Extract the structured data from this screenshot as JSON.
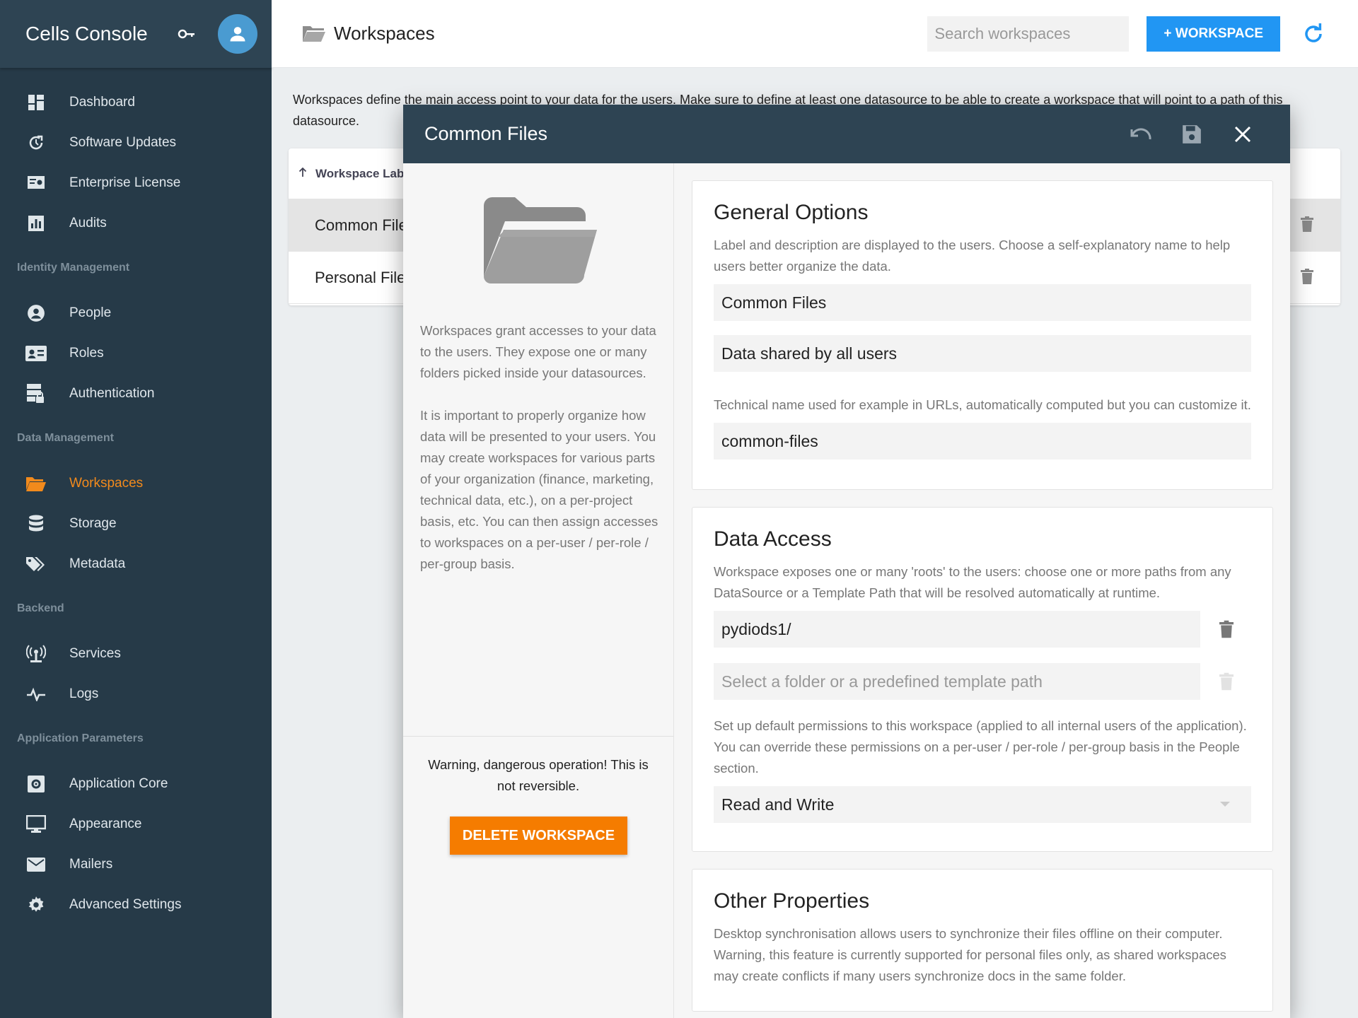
{
  "app": {
    "title": "Cells Console"
  },
  "sidebar": {
    "items": [
      {
        "label": "Dashboard",
        "icon": "dashboard-icon"
      },
      {
        "label": "Software Updates",
        "icon": "update-icon"
      },
      {
        "label": "Enterprise License",
        "icon": "license-icon"
      },
      {
        "label": "Audits",
        "icon": "audits-icon"
      }
    ],
    "sections": [
      {
        "label": "Identity Management",
        "items": [
          "People",
          "Roles",
          "Authentication"
        ]
      },
      {
        "label": "Data Management",
        "items": [
          "Workspaces",
          "Storage",
          "Metadata"
        ]
      },
      {
        "label": "Backend",
        "items": [
          "Services",
          "Logs"
        ]
      },
      {
        "label": "Application Parameters",
        "items": [
          "Application Core",
          "Appearance",
          "Mailers",
          "Advanced Settings"
        ]
      }
    ],
    "active": "Workspaces",
    "active_color": "#f28a1c"
  },
  "topbar": {
    "title": "Workspaces",
    "search_placeholder": "Search workspaces",
    "add_label": "+ WORKSPACE",
    "accent": "#2196f3"
  },
  "page": {
    "description": "Workspaces define the main access point to your data for the users. Make sure to define at least one datasource to be able to create a workspace that will point to a path of this datasource.",
    "table": {
      "header": "Workspace Label",
      "rows": [
        "Common Files",
        "Personal Files"
      ]
    }
  },
  "modal": {
    "title": "Common Files",
    "help_p1": "Workspaces grant accesses to your data to the users. They expose one or many folders picked inside your datasources.",
    "help_p2": "It is important to properly organize how data will be presented to your users. You may create workspaces for various parts of your organization (finance, marketing, technical data, etc.), on a per-project basis, etc. You can then assign accesses to workspaces on a per-user / per-role / per-group basis.",
    "warning": "Warning, dangerous operation! This is not reversible.",
    "delete_label": "DELETE WORKSPACE",
    "delete_color": "#f57c00",
    "general": {
      "title": "General Options",
      "legend": "Label and description are displayed to the users. Choose a self-explanatory name to help users better organize the data.",
      "label_value": "Common Files",
      "description_value": "Data shared by all users",
      "slug_legend": "Technical name used for example in URLs, automatically computed but you can customize it.",
      "slug_value": "common-files"
    },
    "access": {
      "title": "Data Access",
      "legend": "Workspace exposes one or many 'roots' to the users: choose one or more paths from any DataSource or a Template Path that will be resolved automatically at runtime.",
      "root_value": "pydiods1/",
      "root_placeholder": "Select a folder or a predefined template path",
      "perm_legend": "Set up default permissions to this workspace (applied to all internal users of the application). You can override these permissions on a per-user / per-role / per-group basis in the People section.",
      "perm_value": "Read and Write"
    },
    "other": {
      "title": "Other Properties",
      "legend": "Desktop synchronisation allows users to synchronize their files offline on their computer. Warning, this feature is currently supported for personal files only, as shared workspaces may create conflicts if many users synchronize docs in the same folder."
    }
  }
}
